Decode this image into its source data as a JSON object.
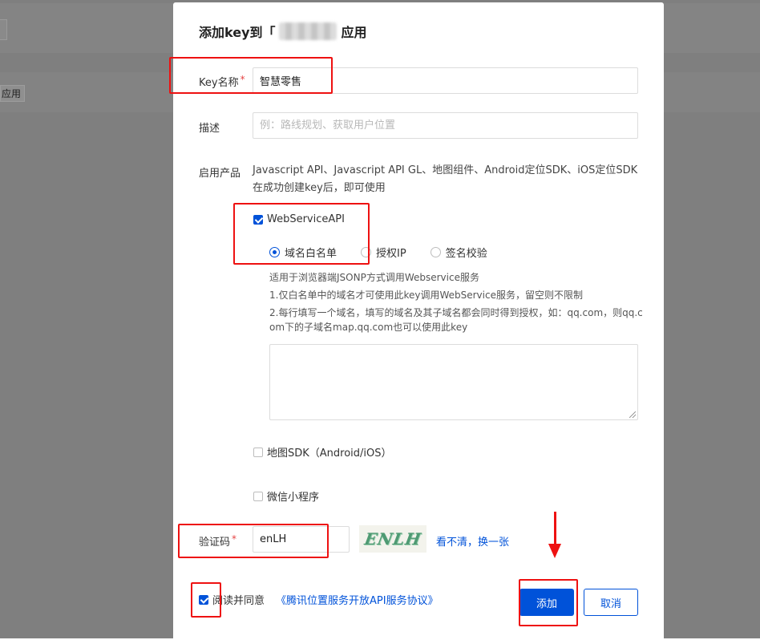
{
  "background": {
    "app_button_label": "应用"
  },
  "dialog": {
    "title_prefix": "添加key到「",
    "title_suffix": "应用",
    "key_name": {
      "label": "Key名称",
      "required_mark": "*",
      "value": "智慧零售"
    },
    "description": {
      "label": "描述",
      "placeholder": "例：路线规划、获取用户位置"
    },
    "products": {
      "label": "启用产品",
      "intro": "Javascript API、Javascript API GL、地图组件、Android定位SDK、iOS定位SDK在成功创建key后，即可使用",
      "webservice": {
        "label": "WebServiceAPI",
        "checked": true,
        "auth_options": [
          {
            "label": "域名白名单",
            "selected": true
          },
          {
            "label": "授权IP",
            "selected": false
          },
          {
            "label": "签名校验",
            "selected": false
          }
        ],
        "hint_line1": "适用于浏览器端JSONP方式调用Webservice服务",
        "hint_line2": "1.仅白名单中的域名才可使用此key调用WebService服务，留空则不限制",
        "hint_line3a": "2.每行填写一个域名，填写的域名及其子域名都会同时得到授权，如：qq.com，则qq.c",
        "hint_line3b": "om下的子域名map.qq.com也可以使用此key",
        "domain_list_value": ""
      },
      "map_sdk": {
        "label": "地图SDK（Android/iOS）",
        "checked": false
      },
      "wechat": {
        "label": "微信小程序",
        "checked": false
      }
    },
    "captcha": {
      "label": "验证码",
      "required_mark": "*",
      "value": "enLH",
      "image_text": "ENLH",
      "refresh_label": "看不清，换一张"
    },
    "agreement": {
      "checked": true,
      "text": "阅读并同意",
      "link": "《腾讯位置服务开放API服务协议》"
    },
    "buttons": {
      "add": "添加",
      "cancel": "取消"
    }
  },
  "colors": {
    "primary": "#0052d9",
    "annotation": "#ee1111",
    "required": "#e54545"
  }
}
